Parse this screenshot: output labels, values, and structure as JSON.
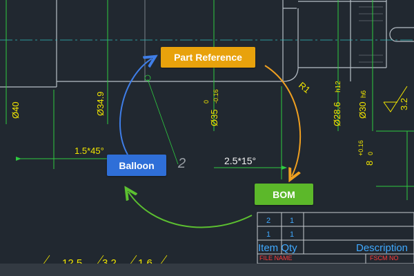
{
  "colors": {
    "background": "#212830",
    "geometry": "#b8c0c8",
    "dimension_line": "#2ecc40",
    "dimension_text": "#f2e600",
    "centerline": "#30c0c0",
    "table_text": "#3fa9ff",
    "table_label": "#ff3b3b",
    "part_reference_tag": "#e8a20c",
    "balloon_tag": "#2f6fd8",
    "bom_tag": "#5cb82a"
  },
  "tags": {
    "part_reference": "Part Reference",
    "balloon": "Balloon",
    "bom": "BOM"
  },
  "drawing": {
    "dim_d40": "Ø40",
    "dim_d349": "Ø34.9",
    "dim_d35": "Ø35",
    "dim_d35_tol_upper": "0",
    "dim_d35_tol_lower": "-0.16",
    "dim_d286": "Ø28.6",
    "dim_d286_fit": "h12",
    "dim_d30": "Ø30",
    "dim_d30_fit": "h6",
    "dim_r1": "R1",
    "dim_chamfer_left": "1.5*45°",
    "dim_chamfer_right": "2.5*15°",
    "dim_8": "8",
    "dim_8_tol_upper": "+0.16",
    "dim_8_tol_lower": "0",
    "roughness_value": "3.2",
    "balloon_label": "2",
    "bottom_dim_1": "12.5",
    "bottom_dim_2": "3.2",
    "bottom_dim_3": "1.6"
  },
  "bom_table": {
    "rows": [
      {
        "item": "2",
        "qty": "1"
      },
      {
        "item": "1",
        "qty": "1"
      }
    ],
    "header_item_qty": "Item Qty",
    "header_description": "Description",
    "label_file_name": "FILE NAME",
    "label_fscm": "FSCM NO"
  }
}
